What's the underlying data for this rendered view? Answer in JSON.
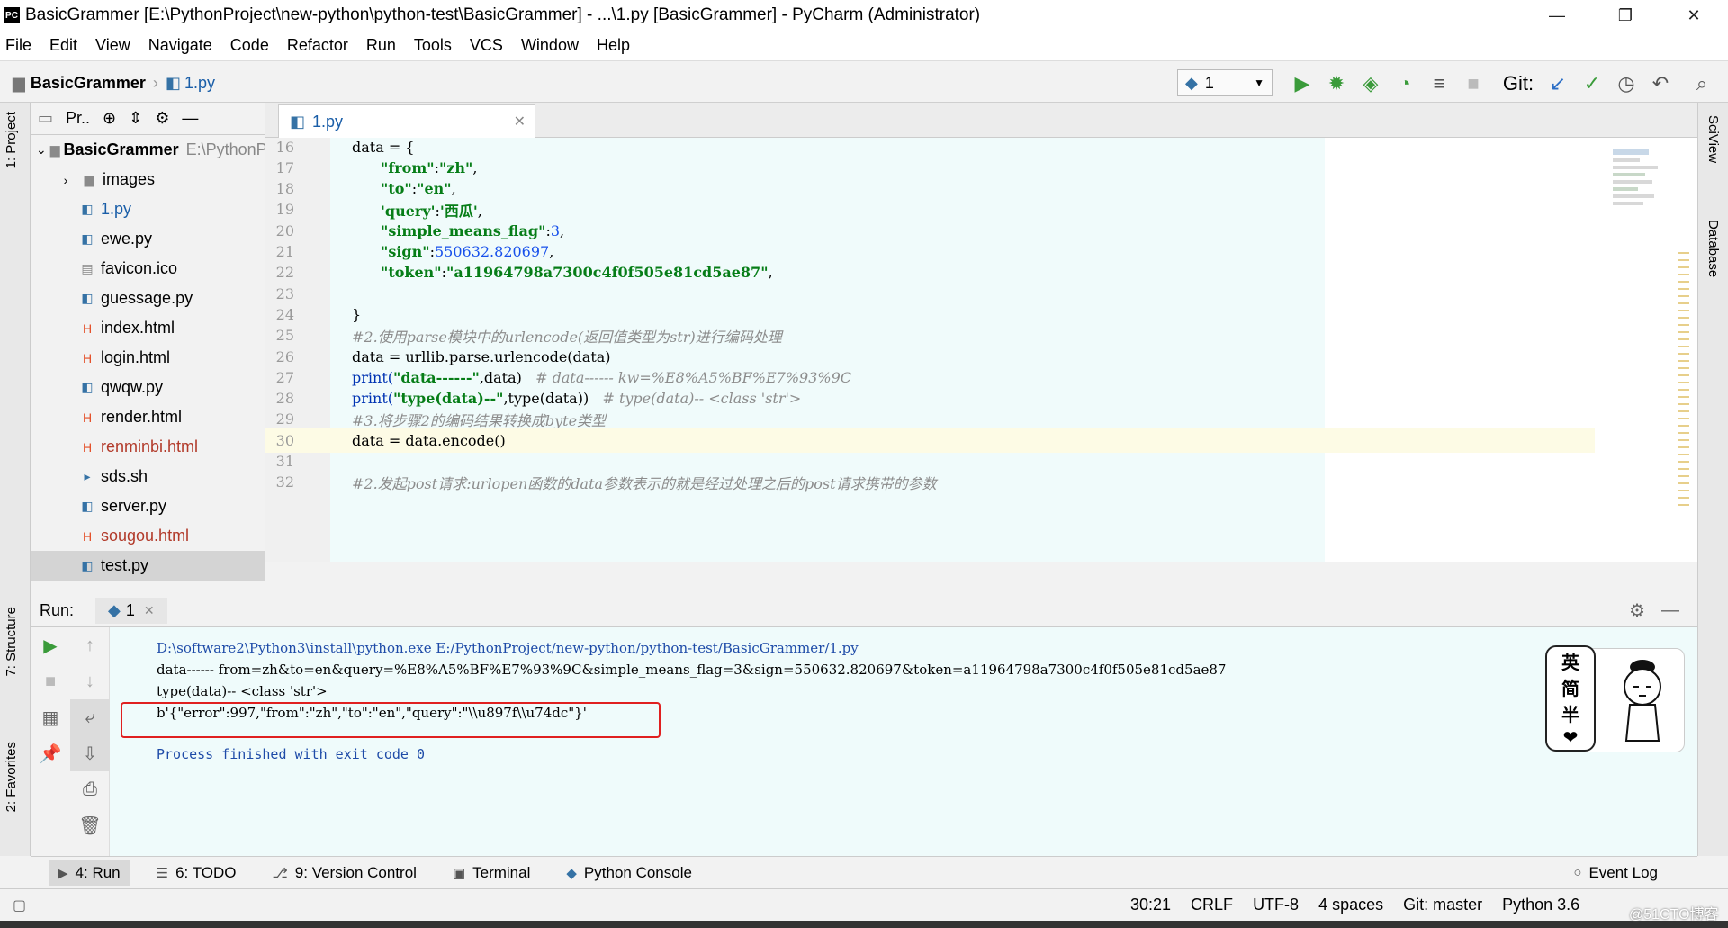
{
  "window": {
    "title": "BasicGrammer [E:\\PythonProject\\new-python\\python-test\\BasicGrammer] - ...\\1.py [BasicGrammer] - PyCharm (Administrator)"
  },
  "menu": [
    "File",
    "Edit",
    "View",
    "Navigate",
    "Code",
    "Refactor",
    "Run",
    "Tools",
    "VCS",
    "Window",
    "Help"
  ],
  "breadcrumb": {
    "project": "BasicGrammer",
    "file": "1.py"
  },
  "toolbar": {
    "run_config": "1",
    "git_label": "Git:"
  },
  "project_panel": {
    "title": "Pr..",
    "root_name": "BasicGrammer",
    "root_path": "E:\\PythonProject",
    "items": [
      {
        "name": "images",
        "type": "dir"
      },
      {
        "name": "1.py",
        "type": "py",
        "color": "#1a5ea8"
      },
      {
        "name": "ewe.py",
        "type": "py"
      },
      {
        "name": "favicon.ico",
        "type": "ico"
      },
      {
        "name": "guessage.py",
        "type": "py"
      },
      {
        "name": "index.html",
        "type": "html"
      },
      {
        "name": "login.html",
        "type": "html"
      },
      {
        "name": "qwqw.py",
        "type": "py"
      },
      {
        "name": "render.html",
        "type": "html"
      },
      {
        "name": "renminbi.html",
        "type": "html",
        "color": "#b23a2a"
      },
      {
        "name": "sds.sh",
        "type": "sh"
      },
      {
        "name": "server.py",
        "type": "py"
      },
      {
        "name": "sougou.html",
        "type": "html",
        "color": "#b23a2a"
      },
      {
        "name": "test.py",
        "type": "py",
        "selected": true
      }
    ]
  },
  "editor": {
    "tab": "1.py",
    "lines": [
      {
        "n": "16",
        "text": "data = {"
      },
      {
        "n": "17",
        "key": "\"from\"",
        "val": "\"zh\"",
        "tail": ","
      },
      {
        "n": "18",
        "key": "\"to\"",
        "val": "\"en\"",
        "tail": ","
      },
      {
        "n": "19",
        "key": "'query'",
        "val": "'西瓜'",
        "tail": ","
      },
      {
        "n": "20",
        "key": "\"simple_means_flag\"",
        "num": "3",
        "tail": ","
      },
      {
        "n": "21",
        "key": "\"sign\"",
        "num": "550632.820697",
        "tail": ","
      },
      {
        "n": "22",
        "key": "\"token\"",
        "val": "\"a11964798a7300c4f0f505e81cd5ae87\"",
        "tail": ","
      },
      {
        "n": "23",
        "text": ""
      },
      {
        "n": "24",
        "text": "}"
      },
      {
        "n": "25",
        "comment": "#2.使用parse模块中的urlencode(返回值类型为str)进行编码处理"
      },
      {
        "n": "26",
        "text": "data = urllib.parse.urlencode(data)"
      },
      {
        "n": "27",
        "print1": "print(",
        "str": "\"data------\"",
        "rest": ",data)",
        "comment": "# data------ kw=%E8%A5%BF%E7%93%9C"
      },
      {
        "n": "28",
        "print1": "print(",
        "str": "\"type(data)--\"",
        "rest": ",type(data))",
        "comment": "# type(data)-- <class 'str'>"
      },
      {
        "n": "29",
        "comment": "#3.将步骤2的编码结果转换成byte类型"
      },
      {
        "n": "30",
        "text": "data = data.encode()"
      },
      {
        "n": "31",
        "text": ""
      },
      {
        "n": "32",
        "comment": "#2.发起post请求:urlopen函数的data参数表示的就是经过处理之后的post请求携带的参数"
      }
    ]
  },
  "run_panel": {
    "label": "Run:",
    "tab": "1",
    "output": [
      "D:\\software2\\Python3\\install\\python.exe E:/PythonProject/new-python/python-test/BasicGrammer/1.py",
      "data------ from=zh&to=en&query=%E8%A5%BF%E7%93%9C&simple_means_flag=3&sign=550632.820697&token=a11964798a7300c4f0f505e81cd5ae87",
      "type(data)-- <class 'str'>",
      "b'{\"error\":997,\"from\":\"zh\",\"to\":\"en\",\"query\":\"\\\\u897f\\\\u74dc\"}'",
      "",
      "Process finished with exit code 0"
    ],
    "sticker_text": [
      "英",
      "简",
      "半"
    ]
  },
  "side_tabs": {
    "left": [
      "1: Project",
      "7: Structure",
      "2: Favorites"
    ],
    "right": [
      "SciView",
      "Database"
    ]
  },
  "bottom_tabs": [
    {
      "label": "4: Run",
      "active": true
    },
    {
      "label": "6: TODO"
    },
    {
      "label": "9: Version Control"
    },
    {
      "label": "Terminal"
    },
    {
      "label": "Python Console"
    }
  ],
  "event_log": "Event Log",
  "status": {
    "position": "30:21",
    "line_sep": "CRLF",
    "encoding": "UTF-8",
    "indent": "4 spaces",
    "git": "Git: master",
    "interpreter": "Python 3.6"
  },
  "watermark": "@51CTO博客",
  "colors": {
    "accent": "#1a5ea8",
    "highlight_box": "#e02020",
    "run_green": "#3a9b3a"
  }
}
